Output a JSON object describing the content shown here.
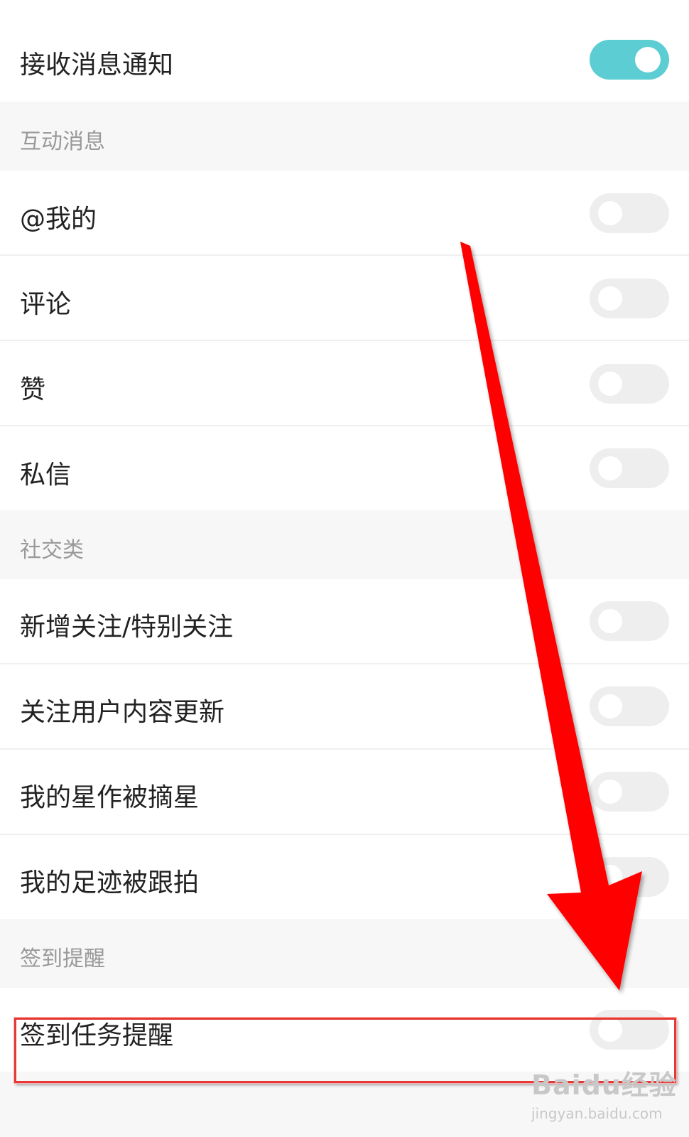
{
  "settings": {
    "receive_notifications": {
      "label": "接收消息通知",
      "enabled": true
    },
    "sections": [
      {
        "title": "互动消息",
        "items": [
          {
            "label": "@我的",
            "enabled": false
          },
          {
            "label": "评论",
            "enabled": false
          },
          {
            "label": "赞",
            "enabled": false
          },
          {
            "label": "私信",
            "enabled": false
          }
        ]
      },
      {
        "title": "社交类",
        "items": [
          {
            "label": "新增关注/特别关注",
            "enabled": false
          },
          {
            "label": "关注用户内容更新",
            "enabled": false
          },
          {
            "label": "我的星作被摘星",
            "enabled": false
          },
          {
            "label": "我的足迹被跟拍",
            "enabled": false
          }
        ]
      },
      {
        "title": "签到提醒",
        "items": [
          {
            "label": "签到任务提醒",
            "enabled": false
          }
        ]
      }
    ]
  },
  "colors": {
    "toggle_on": "#5ccdd3",
    "toggle_off": "#eeeeee",
    "annotation": "#e53935"
  },
  "watermark": {
    "brand": "Baidu经验",
    "url": "jingyan.baidu.com"
  }
}
